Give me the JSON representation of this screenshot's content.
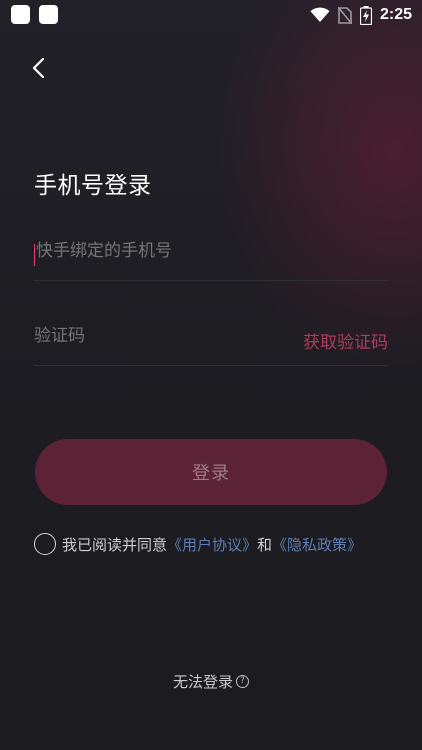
{
  "status_bar": {
    "time": "2:25"
  },
  "page": {
    "title": "手机号登录"
  },
  "phone_field": {
    "placeholder": "快手绑定的手机号"
  },
  "code_field": {
    "placeholder": "验证码",
    "get_code_label": "获取验证码"
  },
  "login_button": {
    "label": "登录"
  },
  "agreement": {
    "prefix": "我已阅读并同意",
    "user_agreement": "《用户协议》",
    "conjunction": "和",
    "privacy_policy": "《隐私政策》"
  },
  "footer": {
    "cant_login_label": "无法登录",
    "help_icon": "?"
  },
  "colors": {
    "accent": "#b23a5a",
    "button_bg": "#5b2335",
    "link": "#5d7fb5",
    "background": "#1b1b20"
  }
}
